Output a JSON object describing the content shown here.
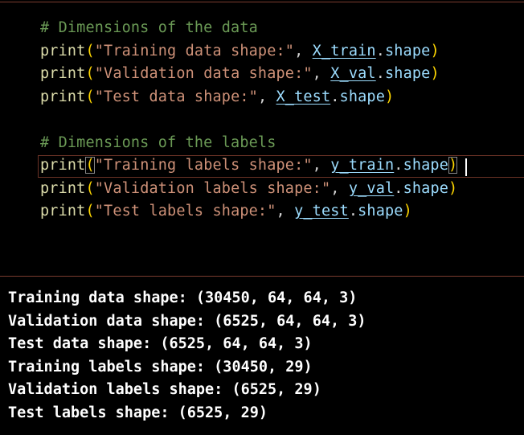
{
  "code": {
    "comment_data": "# Dimensions of the data",
    "comment_labels": "# Dimensions of the labels",
    "print": "print",
    "open": "(",
    "close": ")",
    "comma": ", ",
    "dot": ".",
    "shape": "shape",
    "lines": [
      {
        "str": "\"Training data shape:\"",
        "var": "X_train"
      },
      {
        "str": "\"Validation data shape:\"",
        "var": "X_val"
      },
      {
        "str": "\"Test data shape:\"",
        "var": "X_test"
      },
      {
        "str": "\"Training labels shape:\"",
        "var": "y_train"
      },
      {
        "str": "\"Validation labels shape:\"",
        "var": "y_val"
      },
      {
        "str": "\"Test labels shape:\"",
        "var": "y_test"
      }
    ]
  },
  "output": {
    "lines": [
      "Training data shape: (30450, 64, 64, 3)",
      "Validation data shape: (6525, 64, 64, 3)",
      "Test data shape: (6525, 64, 64, 3)",
      "Training labels shape: (30450, 29)",
      "Validation labels shape: (6525, 29)",
      "Test labels shape: (6525, 29)"
    ]
  },
  "colors": {
    "background": "#000000",
    "comment": "#6a9955",
    "function": "#dcdcaa",
    "string": "#ce9178",
    "variable": "#9cdcfe",
    "bracket_outer": "#ffd700",
    "divider": "#7a3b2e",
    "output_text": "#ffffff"
  }
}
